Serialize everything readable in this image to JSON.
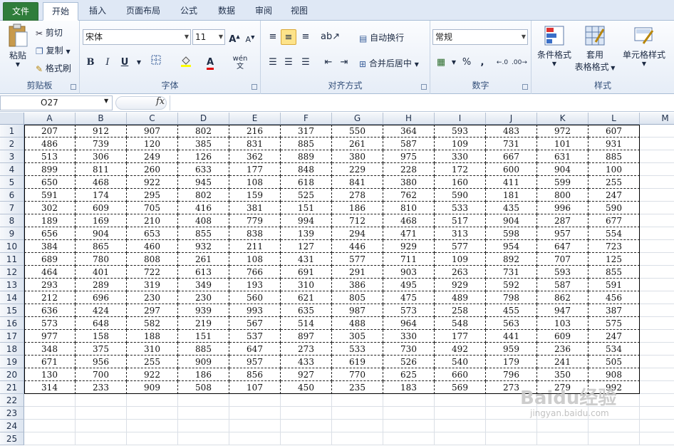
{
  "tabs": [
    {
      "id": "tab-file",
      "label": "文件"
    },
    {
      "id": "tab-home",
      "label": "开始"
    },
    {
      "id": "tab-insert",
      "label": "插入"
    },
    {
      "id": "tab-layout",
      "label": "页面布局"
    },
    {
      "id": "tab-formula",
      "label": "公式"
    },
    {
      "id": "tab-data",
      "label": "数据"
    },
    {
      "id": "tab-review",
      "label": "审阅"
    },
    {
      "id": "tab-view",
      "label": "视图"
    }
  ],
  "clipboard": {
    "paste": "粘贴",
    "cut": "剪切",
    "copy": "复制",
    "format_painter": "格式刷",
    "group": "剪贴板"
  },
  "font": {
    "name": "宋体",
    "size": "11",
    "bold": "B",
    "italic": "I",
    "underline": "U",
    "group": "字体"
  },
  "alignment": {
    "wrap": "自动换行",
    "merge": "合并后居中",
    "group": "对齐方式"
  },
  "number": {
    "format": "常规",
    "percent": "%",
    "comma": ",",
    "group": "数字"
  },
  "styles": {
    "conditional": "条件格式",
    "table_fmt_1": "套用",
    "table_fmt_2": "表格格式",
    "cell_styles": "单元格样式",
    "group": "样式"
  },
  "formula_bar": {
    "name_box": "O27",
    "fx": "fx",
    "value": ""
  },
  "columns": [
    "A",
    "B",
    "C",
    "D",
    "E",
    "F",
    "G",
    "H",
    "I",
    "J",
    "K",
    "L",
    "M"
  ],
  "rows": [
    [
      207,
      912,
      907,
      802,
      216,
      317,
      550,
      364,
      593,
      483,
      972,
      607
    ],
    [
      486,
      739,
      120,
      385,
      831,
      885,
      261,
      587,
      109,
      731,
      101,
      931
    ],
    [
      513,
      306,
      249,
      126,
      362,
      889,
      380,
      975,
      330,
      667,
      631,
      885
    ],
    [
      899,
      811,
      260,
      633,
      177,
      848,
      229,
      228,
      172,
      600,
      904,
      100
    ],
    [
      650,
      468,
      922,
      945,
      108,
      618,
      841,
      380,
      160,
      411,
      599,
      255
    ],
    [
      591,
      174,
      295,
      802,
      159,
      525,
      278,
      762,
      590,
      181,
      800,
      247
    ],
    [
      302,
      609,
      705,
      416,
      381,
      151,
      186,
      810,
      533,
      435,
      996,
      590
    ],
    [
      189,
      169,
      210,
      408,
      779,
      994,
      712,
      468,
      517,
      904,
      287,
      677
    ],
    [
      656,
      904,
      653,
      855,
      838,
      139,
      294,
      471,
      313,
      598,
      957,
      554
    ],
    [
      384,
      865,
      460,
      932,
      211,
      127,
      446,
      929,
      577,
      954,
      647,
      723
    ],
    [
      689,
      780,
      808,
      261,
      108,
      431,
      577,
      711,
      109,
      892,
      707,
      125
    ],
    [
      464,
      401,
      722,
      613,
      766,
      691,
      291,
      903,
      263,
      731,
      593,
      855
    ],
    [
      293,
      289,
      319,
      349,
      193,
      310,
      386,
      495,
      929,
      592,
      587,
      591
    ],
    [
      212,
      696,
      230,
      230,
      560,
      621,
      805,
      475,
      489,
      798,
      862,
      456
    ],
    [
      636,
      424,
      297,
      939,
      993,
      635,
      987,
      573,
      258,
      455,
      947,
      387
    ],
    [
      573,
      648,
      582,
      219,
      567,
      514,
      488,
      964,
      548,
      563,
      103,
      575
    ],
    [
      977,
      158,
      188,
      151,
      537,
      897,
      305,
      330,
      177,
      441,
      609,
      247
    ],
    [
      348,
      375,
      310,
      885,
      647,
      273,
      533,
      730,
      492,
      959,
      236,
      534
    ],
    [
      671,
      956,
      255,
      909,
      957,
      433,
      619,
      526,
      540,
      179,
      241,
      505
    ],
    [
      130,
      700,
      922,
      186,
      856,
      927,
      770,
      625,
      660,
      796,
      350,
      908
    ],
    [
      314,
      233,
      909,
      508,
      107,
      450,
      235,
      183,
      569,
      273,
      279,
      992
    ]
  ],
  "row_numbers": [
    1,
    2,
    3,
    4,
    5,
    6,
    7,
    8,
    9,
    10,
    11,
    12,
    13,
    14,
    15,
    16,
    17,
    18,
    19,
    20,
    21,
    22,
    23,
    24,
    25
  ],
  "watermark": {
    "brand": "Baidu经验",
    "url": "jingyan.baidu.com"
  }
}
